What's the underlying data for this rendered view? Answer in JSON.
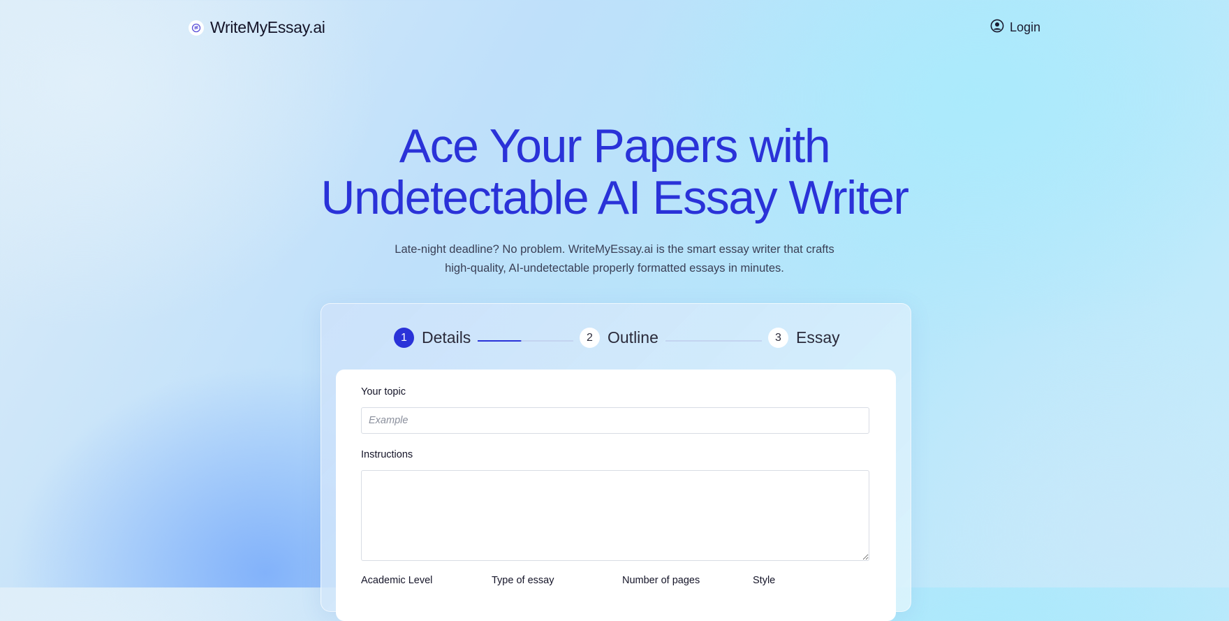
{
  "brand": {
    "name": "WriteMyEssay.ai",
    "logo_icon": "stack-logo-icon"
  },
  "nav": {
    "login_label": "Login",
    "login_icon": "user-circle-icon"
  },
  "hero": {
    "title_line1": "Ace Your Papers with",
    "title_line2": "Undetectable AI Essay Writer",
    "subtitle_line1": "Late-night deadline? No problem. WriteMyEssay.ai is the smart essay writer that crafts",
    "subtitle_line2": "high-quality, AI-undetectable properly formatted essays in minutes."
  },
  "stepper": {
    "steps": [
      {
        "number": "1",
        "label": "Details",
        "active": true
      },
      {
        "number": "2",
        "label": "Outline",
        "active": false
      },
      {
        "number": "3",
        "label": "Essay",
        "active": false
      }
    ]
  },
  "form": {
    "topic_label": "Your topic",
    "topic_placeholder": "Example",
    "topic_value": "",
    "instructions_label": "Instructions",
    "instructions_value": "",
    "academic_level_label": "Academic Level",
    "essay_type_label": "Type of essay",
    "pages_label": "Number of pages",
    "style_label": "Style"
  },
  "colors": {
    "accent": "#2a32d8",
    "text": "#141428",
    "panel": "#ffffff"
  }
}
